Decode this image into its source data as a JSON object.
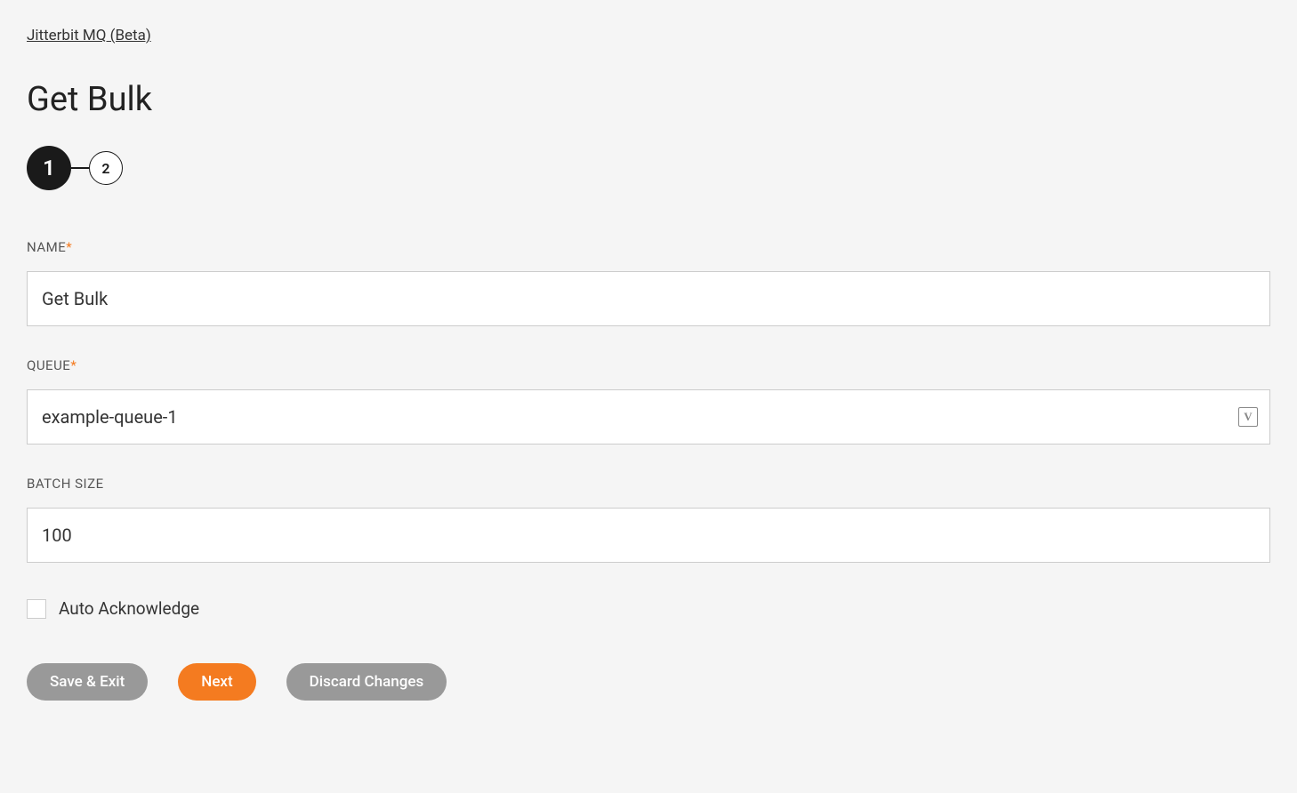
{
  "breadcrumb": {
    "link": "Jitterbit MQ (Beta)"
  },
  "page": {
    "title": "Get Bulk"
  },
  "stepper": {
    "step1": "1",
    "step2": "2"
  },
  "form": {
    "name": {
      "label": "NAME",
      "value": "Get Bulk",
      "required": true
    },
    "queue": {
      "label": "QUEUE",
      "value": "example-queue-1",
      "required": true
    },
    "batchSize": {
      "label": "BATCH SIZE",
      "value": "100",
      "required": false
    },
    "autoAcknowledge": {
      "label": "Auto Acknowledge",
      "checked": false
    }
  },
  "buttons": {
    "saveExit": "Save & Exit",
    "next": "Next",
    "discard": "Discard Changes"
  }
}
